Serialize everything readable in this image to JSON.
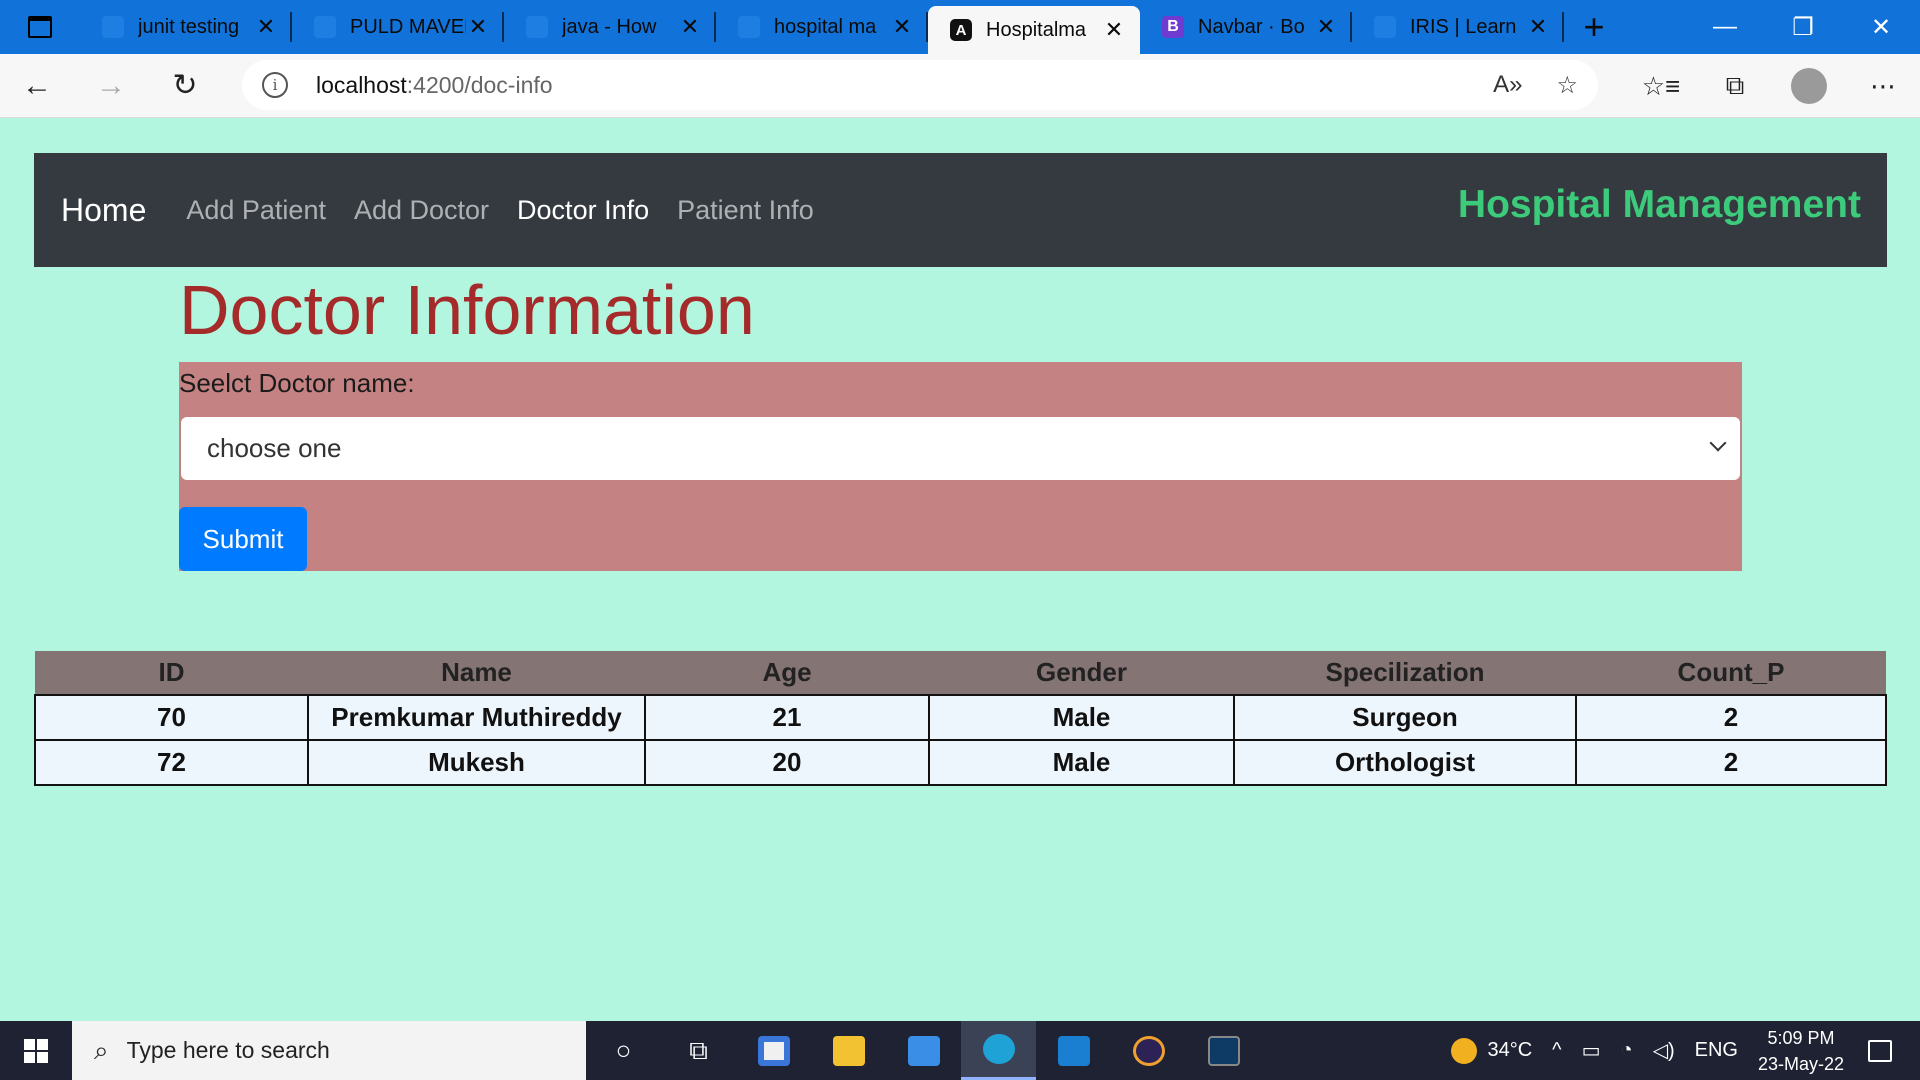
{
  "browser": {
    "tabs": [
      {
        "title": "junit testing",
        "active": false
      },
      {
        "title": "PULD MAVEN",
        "active": false
      },
      {
        "title": "java - How",
        "active": false
      },
      {
        "title": "hospital ma",
        "active": false
      },
      {
        "title": "Hospitalma",
        "active": true
      },
      {
        "title": "Navbar · Bo",
        "active": false
      },
      {
        "title": "IRIS | Learn",
        "active": false
      }
    ],
    "url_host": "localhost",
    "url_path": ":4200/doc-info"
  },
  "navbar": {
    "brand": "Home",
    "links": [
      "Add Patient",
      "Add Doctor",
      "Doctor Info",
      "Patient Info"
    ],
    "app_title": "Hospital Management"
  },
  "page": {
    "heading": "Doctor Information",
    "form": {
      "label": "Seelct Doctor name:",
      "select_value": "choose one",
      "submit_label": "Submit"
    }
  },
  "table": {
    "headers": [
      "ID",
      "Name",
      "Age",
      "Gender",
      "Specilization",
      "Count_P"
    ],
    "rows": [
      [
        "70",
        "Premkumar Muthireddy",
        "21",
        "Male",
        "Surgeon",
        "2"
      ],
      [
        "72",
        "Mukesh",
        "20",
        "Male",
        "Orthologist",
        "2"
      ]
    ]
  },
  "taskbar": {
    "search_placeholder": "Type here to search",
    "temperature": "34°C",
    "language": "ENG",
    "time": "5:09 PM",
    "date": "23-May-22"
  },
  "colors": {
    "page_bg": "#b2f6e0",
    "navbar_bg": "#343a40",
    "app_title": "#3ccb7a",
    "heading": "#a52a2a",
    "form_bg": "#c48283",
    "button": "#007bff",
    "table_header": "#857474"
  }
}
